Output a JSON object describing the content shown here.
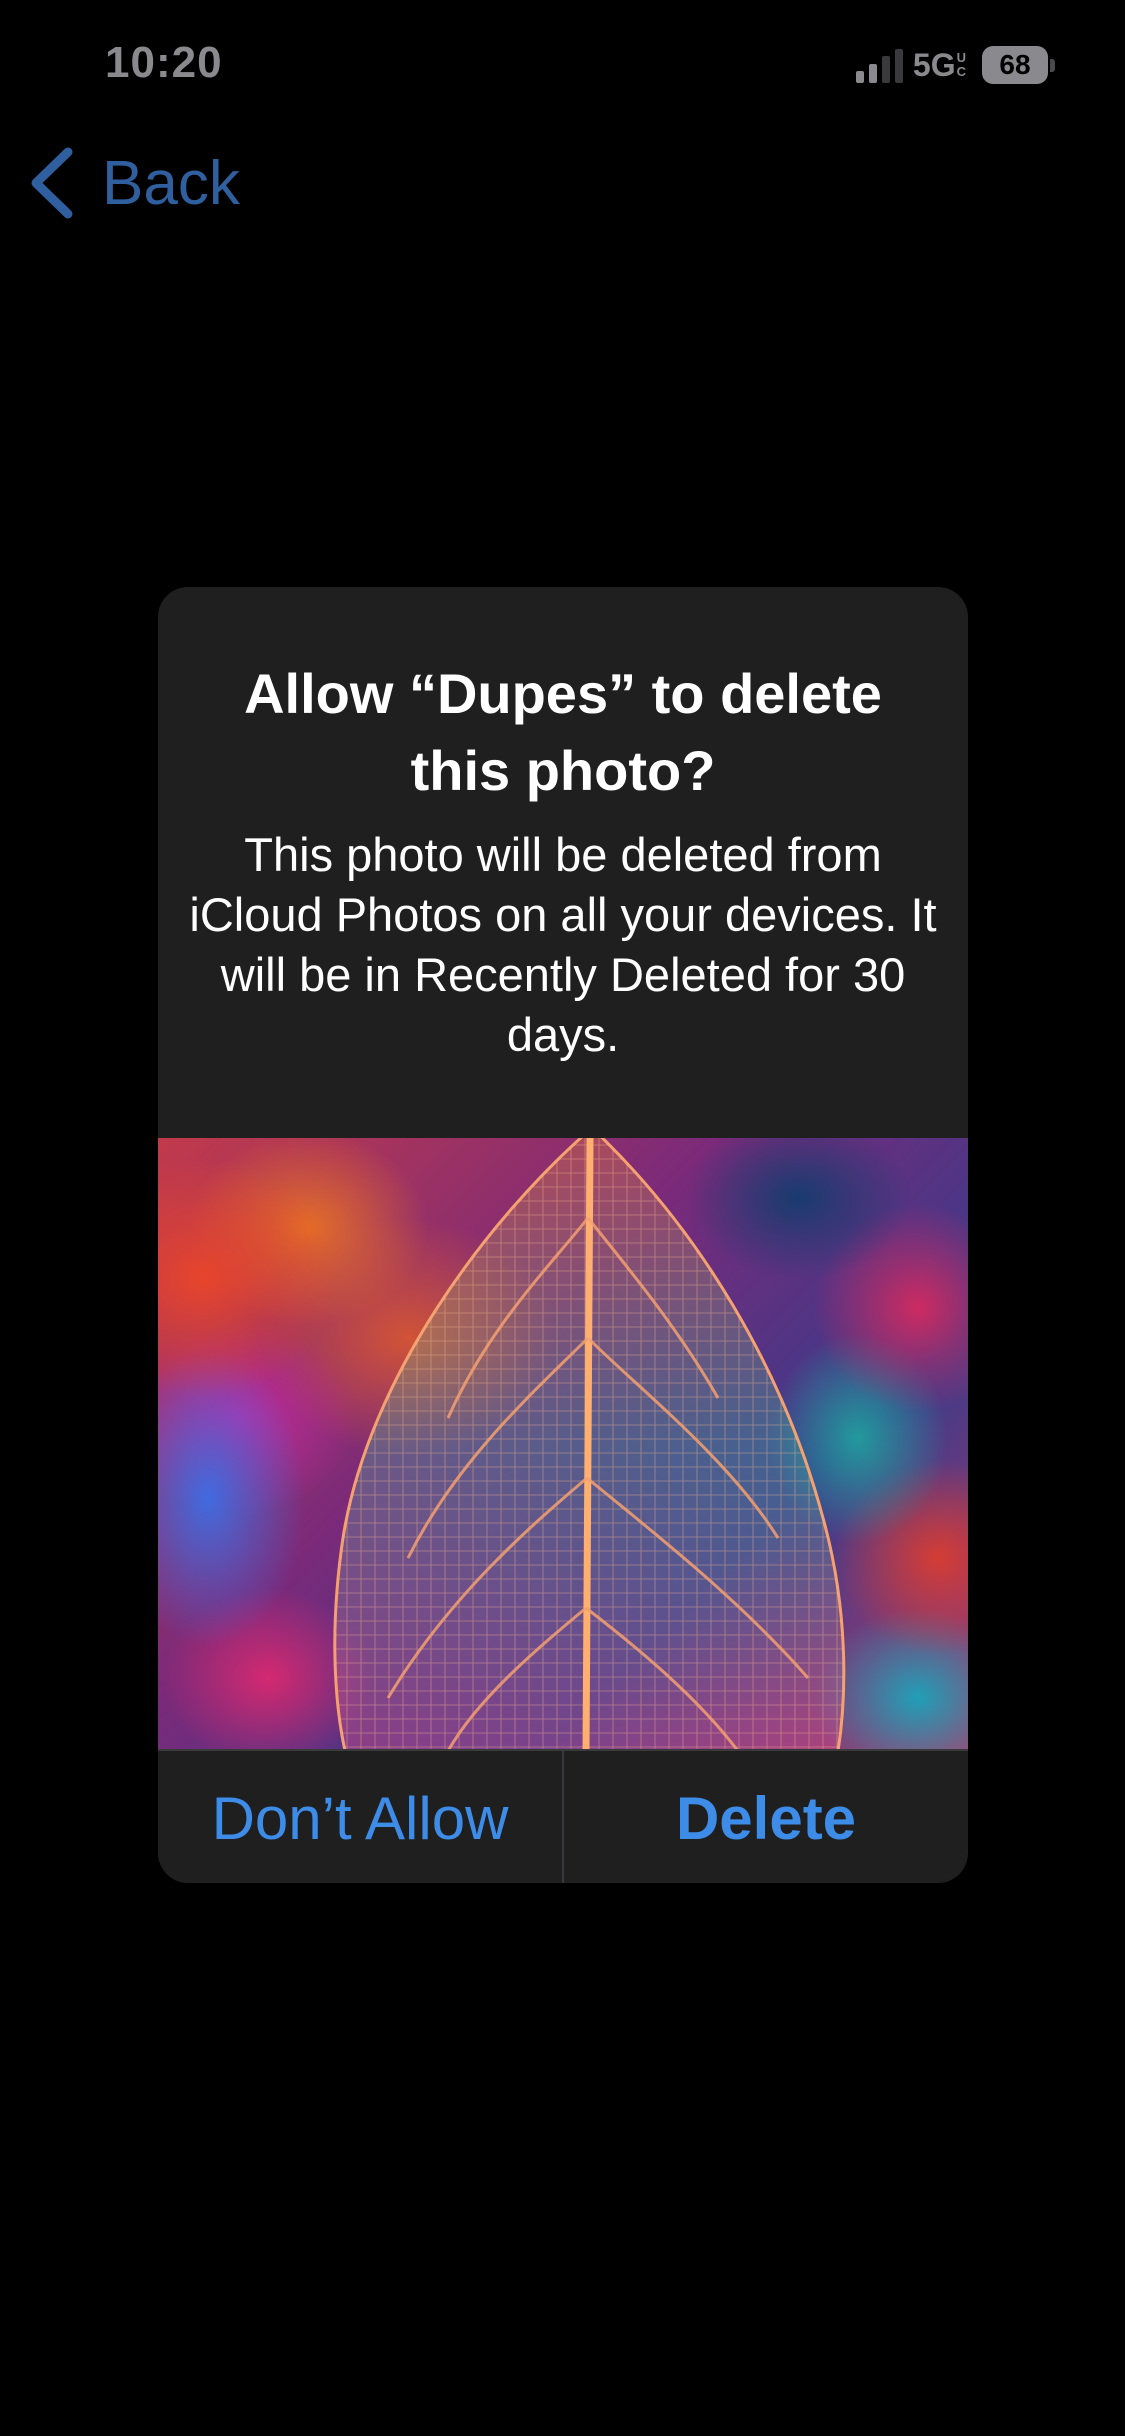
{
  "status_bar": {
    "time": "10:20",
    "network": "5G",
    "network_badge_top": "U",
    "network_badge_bottom": "C",
    "battery_level": "68"
  },
  "nav": {
    "back_label": "Back"
  },
  "alert": {
    "title": "Allow “Dupes” to delete this photo?",
    "message": "This photo will be deleted from iCloud Photos on all your devices. It will be in Recently Deleted for 30 days.",
    "cancel_label": "Don’t Allow",
    "confirm_label": "Delete"
  },
  "colors": {
    "accent": "#3d8ce8",
    "back_link": "#2f5f9e",
    "alert_background": "#1f1f1f",
    "status_gray": "#8a8a8e"
  }
}
